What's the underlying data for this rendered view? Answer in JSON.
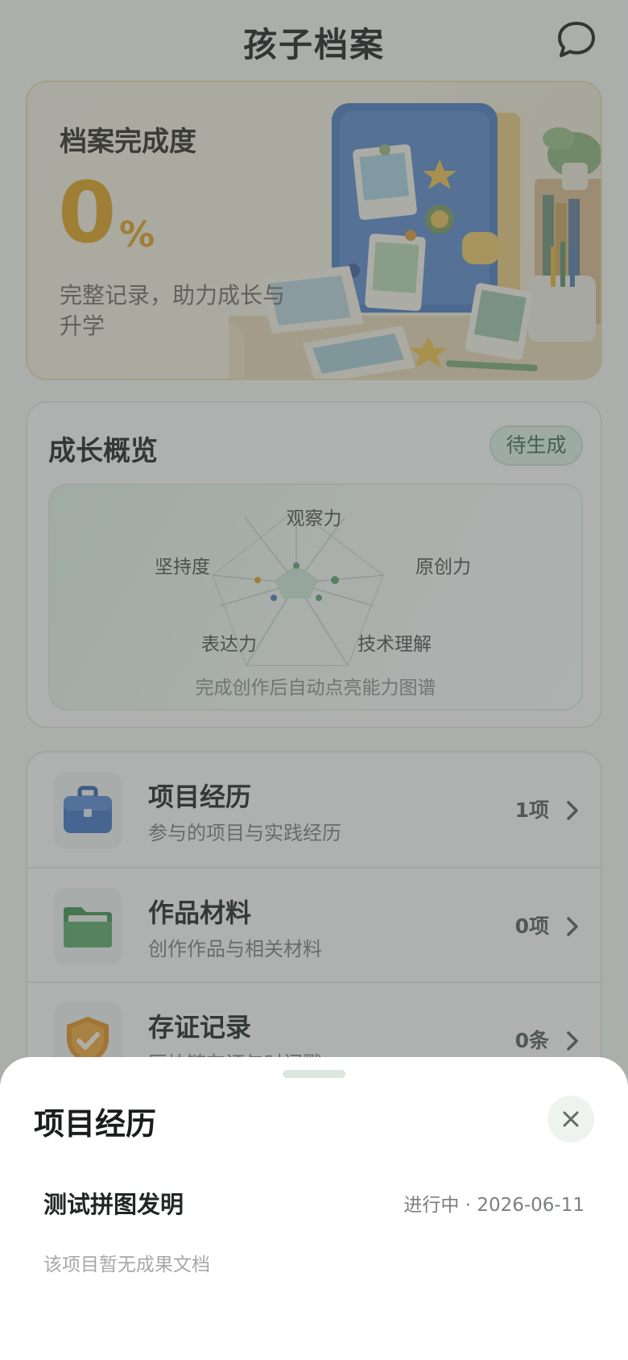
{
  "header": {
    "title": "孩子档案"
  },
  "hero": {
    "title": "档案完成度",
    "value": "0",
    "unit": "%",
    "subtitle": "完整记录，助力成长与升学"
  },
  "growth": {
    "title": "成长概览",
    "badge": "待生成",
    "dimensions": [
      "观察力",
      "原创力",
      "技术理解",
      "表达力",
      "坚持度"
    ],
    "hint": "完成创作后自动点亮能力图谱"
  },
  "list": [
    {
      "title": "项目经历",
      "desc": "参与的项目与实践经历",
      "count": "1项",
      "icon": "briefcase-icon"
    },
    {
      "title": "作品材料",
      "desc": "创作作品与相关材料",
      "count": "0项",
      "icon": "folder-icon"
    },
    {
      "title": "存证记录",
      "desc": "区块链存证与时间戳",
      "count": "0条",
      "icon": "shield-check-icon"
    }
  ],
  "sheet": {
    "title": "项目经历",
    "project_name": "测试拼图发明",
    "project_meta": "进行中 · 2026-06-11",
    "empty_text": "该项目暂无成果文档"
  },
  "colors": {
    "accent_orange": "#e0a11e",
    "accent_green": "#3f6a52",
    "overlay": "rgba(80,86,84,0.45)"
  }
}
